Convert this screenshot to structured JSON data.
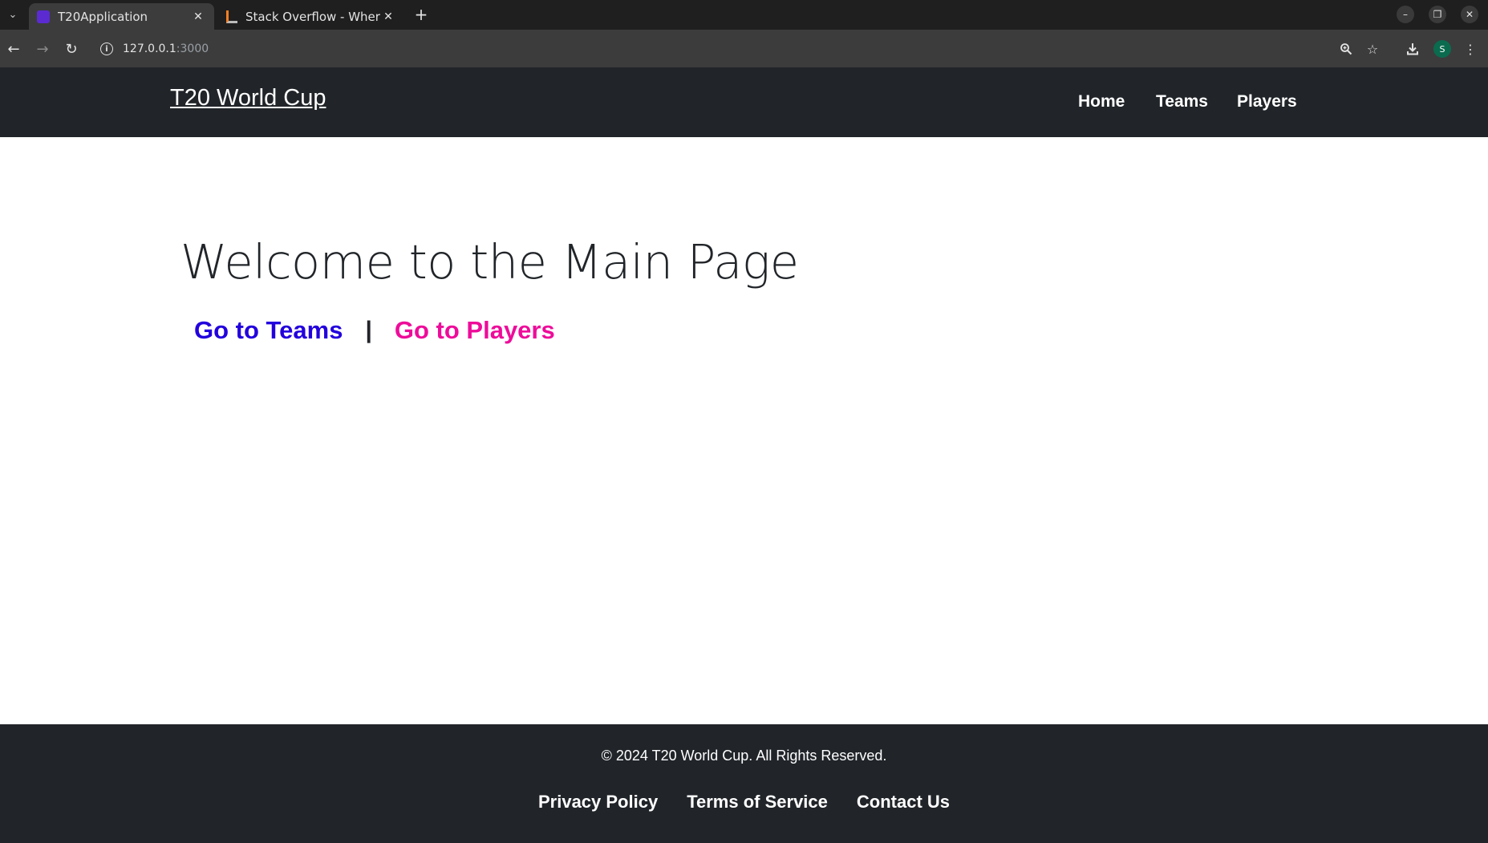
{
  "browser": {
    "tabs": [
      {
        "title": "T20Application",
        "active": true,
        "favicon_color": "#5b2bd1"
      },
      {
        "title": "Stack Overflow - Where ",
        "active": false,
        "favicon_color": "#f48024"
      }
    ],
    "address": {
      "host": "127.0.0.1",
      "port": ":3000"
    },
    "profile_initial": "S"
  },
  "site": {
    "brand": "T20 World Cup",
    "nav": [
      "Home",
      "Teams",
      "Players"
    ]
  },
  "main": {
    "heading": "Welcome to the Main Page",
    "link_teams": "Go to Teams",
    "separator": "|",
    "link_players": "Go to Players"
  },
  "footer": {
    "copyright": "© 2024 T20 World Cup. All Rights Reserved.",
    "links": [
      "Privacy Policy",
      "Terms of Service",
      "Contact Us"
    ]
  },
  "colors": {
    "navbar_bg": "#212529",
    "teams_link": "#2200dd",
    "players_link": "#ee0c9a"
  }
}
